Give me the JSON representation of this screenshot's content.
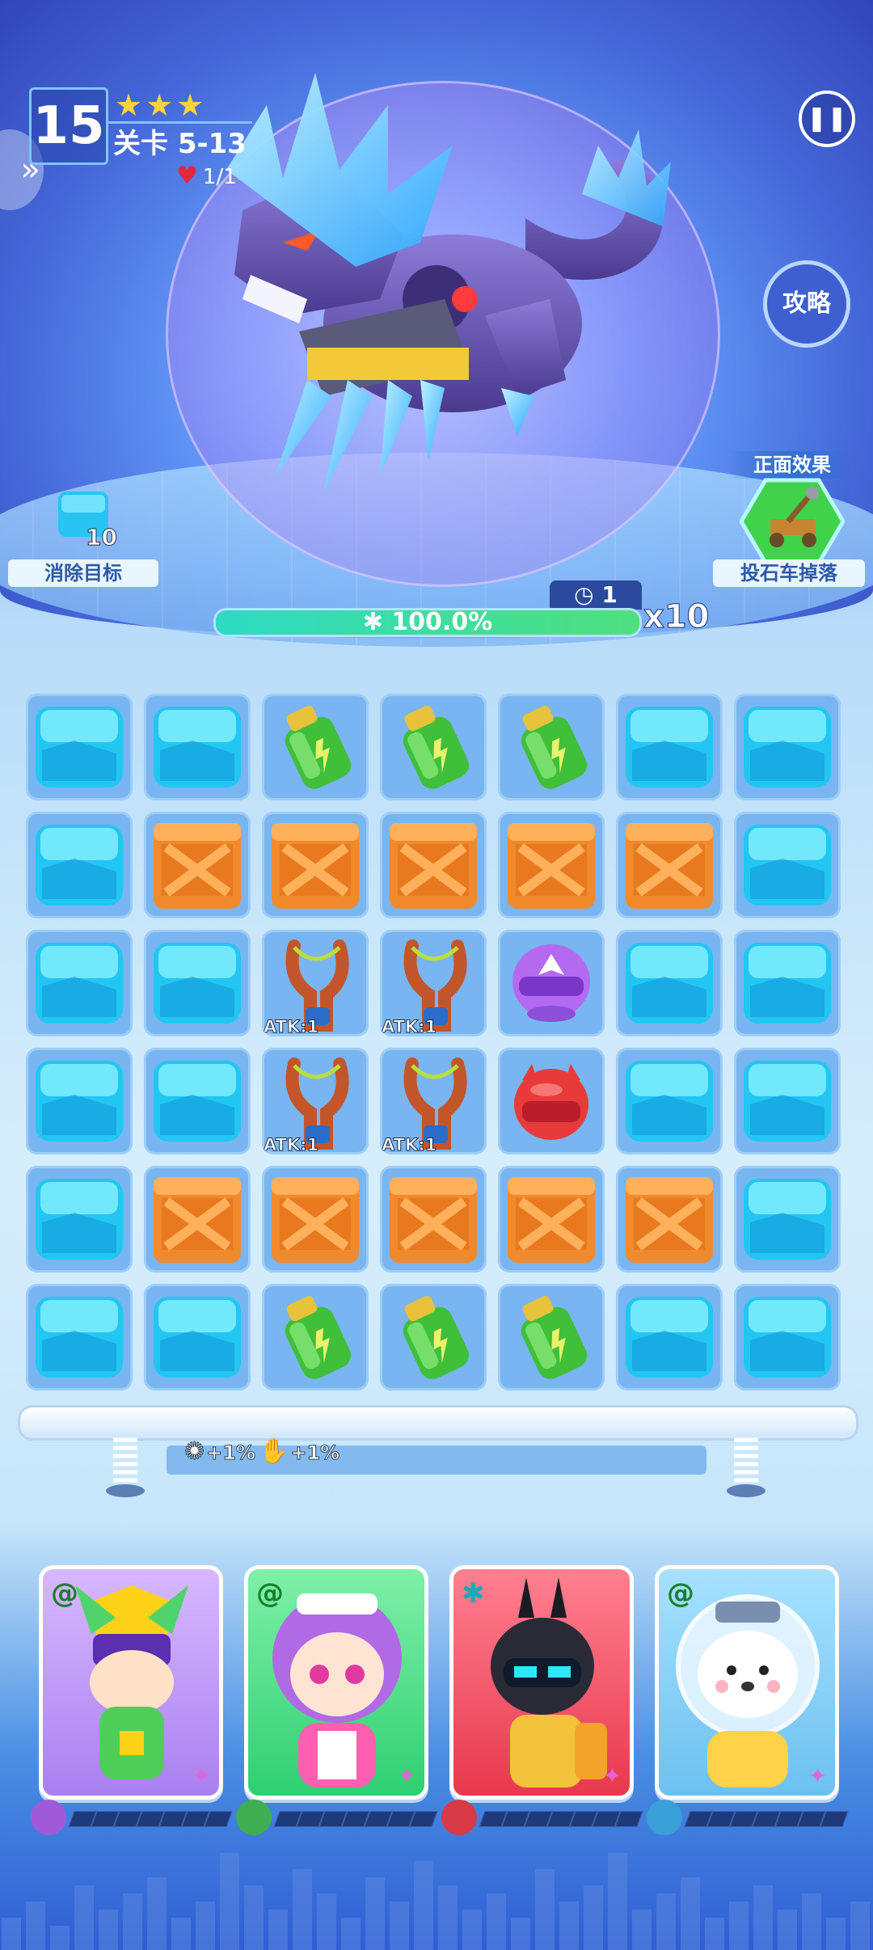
{
  "hud": {
    "level_number": "15",
    "stars": "★★★",
    "level_name": "关卡 5-13",
    "lives": "1/1"
  },
  "buttons": {
    "pause_icon": "pause-icon",
    "strategy_label": "攻略"
  },
  "goal": {
    "count": "10",
    "label": "消除目标"
  },
  "positive_effect": {
    "title": "正面效果",
    "label": "投石车掉落"
  },
  "boss": {
    "turns": "1",
    "hp_text": "100.0%",
    "hp_fraction": 1.0,
    "multiplier": "x10"
  },
  "board": {
    "rows": [
      [
        "ice",
        "ice",
        "potion",
        "potion",
        "potion",
        "ice",
        "ice"
      ],
      [
        "ice",
        "crate",
        "crate",
        "crate",
        "crate",
        "crate",
        "ice"
      ],
      [
        "ice",
        "ice",
        "slingshot",
        "slingshot",
        "helmet-purple",
        "ice",
        "ice"
      ],
      [
        "ice",
        "ice",
        "slingshot",
        "slingshot",
        "helmet-red",
        "ice",
        "ice"
      ],
      [
        "ice",
        "crate",
        "crate",
        "crate",
        "crate",
        "crate",
        "ice"
      ],
      [
        "ice",
        "ice",
        "potion",
        "potion",
        "potion",
        "ice",
        "ice"
      ]
    ],
    "atk_label": "ATK:1"
  },
  "buffs": [
    {
      "icon": "splash-icon",
      "value": "+1%"
    },
    {
      "icon": "hand-icon",
      "value": "+1%"
    }
  ],
  "heroes": [
    {
      "name": "hero-ranger",
      "badge": "spiral-icon",
      "bg": "#c9a7f3"
    },
    {
      "name": "hero-maid",
      "badge": "spiral-icon",
      "bg": "#5fd987"
    },
    {
      "name": "hero-robot",
      "badge": "star-icon",
      "bg": "#f05a6e"
    },
    {
      "name": "hero-bear-astronaut",
      "badge": "spiral-icon",
      "bg": "#7cc7f4"
    }
  ],
  "colors": {
    "ice": "#22c6f2",
    "crate": "#f08a2c",
    "potion": "#3fbf3a",
    "hp_fill": "#3ee0a0"
  }
}
